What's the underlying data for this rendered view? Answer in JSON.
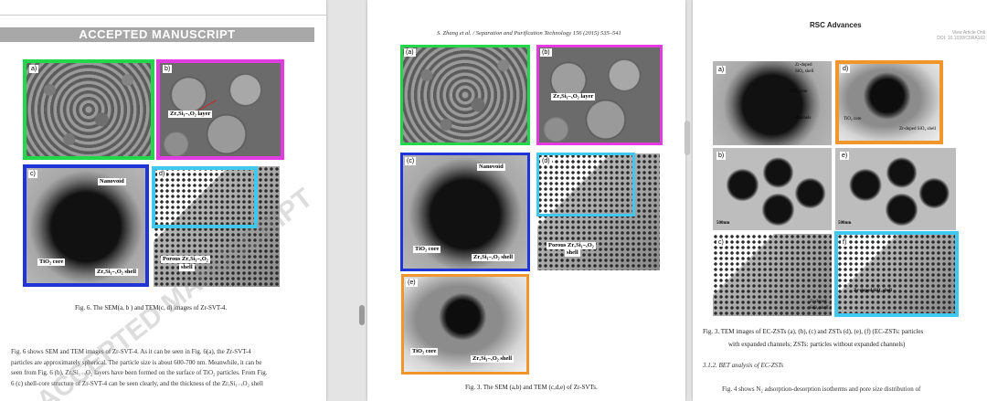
{
  "page1": {
    "banner": "ACCEPTED MANUSCRIPT",
    "watermark": "ACCEPTED MANUSCRIPT",
    "panels": [
      {
        "label": "a)"
      },
      {
        "label": "b)",
        "annotations": [
          "ZrₓSi₁₋ₓO₂ layer"
        ]
      },
      {
        "label": "c)",
        "annotations": [
          "Nanovoid",
          "TiO₂ core",
          "ZrₓSi₁₋ₓO₂ shell"
        ]
      },
      {
        "label": "d)",
        "annotations": [
          "Porous ZrₓSi₁₋ₓO₂",
          "shell"
        ]
      }
    ],
    "caption": "Fig. 6. The SEM(a, b ) and TEM(c, d) images of Zr-SVT-4.",
    "body_lines": [
      "Fig. 6 shows SEM and TEM images of Zr-SVT-4. As it can be seen in Fig. 6(a), the Zr-SVT-4",
      "particles are approximately spherical. The particle size is about 600-700 nm. Meanwhile, it can be",
      "seen from Fig. 6 (b), ZrₓSi₁₋ₓO₂ layers have been formed on the surface of TiO₂ particles. From Fig.",
      "6 (c) shell-core structure of Zr-SVT-4 can be seen clearly, and the thickness of the ZrₓSi₁₋ₓO₂ shell"
    ]
  },
  "page2": {
    "journal_header": "S. Zhang et al. / Separation and Purification Technology 156 (2015) 535–541",
    "panels": [
      {
        "label": "(a)"
      },
      {
        "label": "(b)",
        "annotations": [
          "ZrₓSi₁₋ₓO₂ layer"
        ]
      },
      {
        "label": "(c)",
        "annotations": [
          "Nanovoid",
          "TiO₂ core",
          "ZrₓSi₁₋ₓO₂ shell"
        ]
      },
      {
        "label": "(d)",
        "annotations": [
          "Porous ZrₓSi₁₋ₓO₂",
          "shell"
        ]
      },
      {
        "label": "(e)",
        "annotations": [
          "TiO₂ core",
          "ZrₓSi₁₋ₓO₂ shell"
        ]
      }
    ],
    "caption": "Fig. 3. The SEM (a,b) and TEM (c,d,e) of Zr-SVTs."
  },
  "page3": {
    "journal": "RSC Advances",
    "meta_lines": [
      "View Article Onli",
      "DOI: 10.1039/C5RA162"
    ],
    "panels": [
      {
        "label": "a)",
        "annotations": [
          "Zr-doped",
          "SiO₂ shell",
          "TiO₂ core",
          "channels"
        ]
      },
      {
        "label": "d)",
        "annotations": [
          "TiO₂ core",
          "Zr-doped SiO₂ shell"
        ]
      },
      {
        "label": "b)",
        "annotations": [
          "500nm"
        ]
      },
      {
        "label": "e)",
        "annotations": [
          "500nm"
        ]
      },
      {
        "label": "c)",
        "annotations": [
          "Zr-doped",
          "SiO₂ shell"
        ]
      },
      {
        "label": "f)",
        "annotations": [
          "Zr-doped SiO₂ shell"
        ]
      }
    ],
    "caption_lines": [
      "Fig. 3. TEM images of EC-ZSTs (a), (b), (c) and ZSTs (d), (e), (f) (EC-ZSTs: particles",
      "with expanded channels; ZSTs: particles without expanded channels)"
    ],
    "section_heading": "3.1.2. BET analysis of EC-ZSTs",
    "body_line": "Fig. 4 shows N₂ adsorption-desorption isotherms and pore size distribution of"
  },
  "colors": {
    "green": "#22d84a",
    "magenta": "#e23be0",
    "blue": "#1f35d8",
    "cyan": "#40c8f0",
    "orange": "#f0962a"
  }
}
